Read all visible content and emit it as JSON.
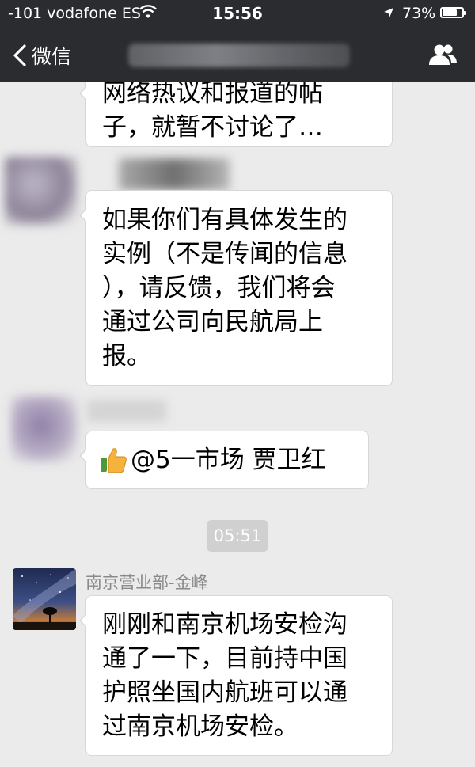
{
  "status_bar": {
    "carrier": "-101 vodafone ES",
    "time": "15:56",
    "battery": "73%"
  },
  "nav": {
    "back_label": "微信"
  },
  "messages": [
    {
      "lines": [
        "网络热议和报道的帖",
        "子，就暂不讨论了…"
      ]
    },
    {
      "lines": [
        "如果你们有具体发生的",
        "实例（不是传闻的信息",
        "），请反馈，我们将会",
        "通过公司向民航局上",
        "报。"
      ]
    },
    {
      "emoji": "thumbs-up",
      "text": "@5一市场 贾卫红"
    }
  ],
  "timestamp": "05:51",
  "sender": {
    "name": "南京营业部-金峰",
    "message_lines": [
      "刚刚和南京机场安检沟",
      "通了一下，目前持中国",
      "护照坐国内航班可以通",
      "过南京机场安检。"
    ]
  },
  "colors": {
    "topbar": "#2b2c2f",
    "chat_background": "#ebebeb",
    "bubble": "#ffffff",
    "timestamp_pill": "#d0d0d0"
  }
}
